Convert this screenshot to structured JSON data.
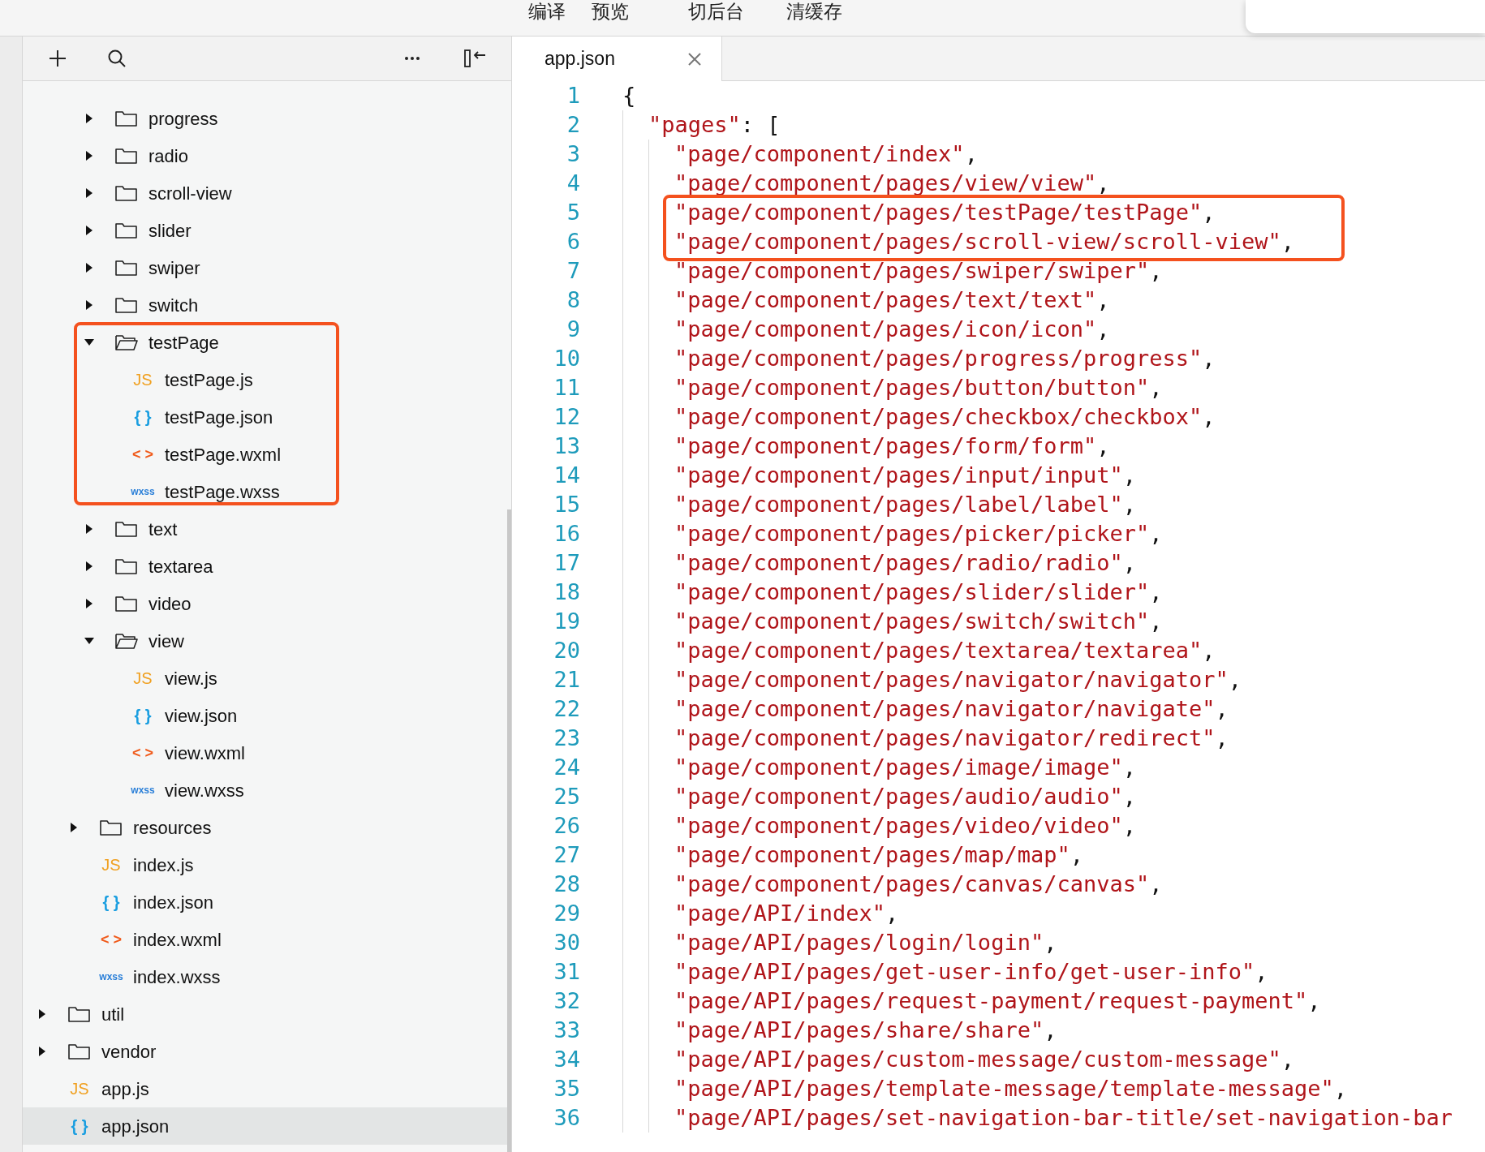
{
  "top_bar": {
    "items": [
      "编译",
      "预览",
      "切后台",
      "清缓存"
    ]
  },
  "sidebar": {
    "tree": [
      {
        "children": [
          {
            "children": [
              {
                "label": "progress",
                "kind": "folder",
                "expanded": false,
                "selected": false
              },
              {
                "label": "radio",
                "kind": "folder",
                "expanded": false,
                "selected": false
              },
              {
                "label": "scroll-view",
                "kind": "folder",
                "expanded": false,
                "selected": false
              },
              {
                "label": "slider",
                "kind": "folder",
                "expanded": false,
                "selected": false
              },
              {
                "label": "swiper",
                "kind": "folder",
                "expanded": false,
                "selected": false
              },
              {
                "label": "switch",
                "kind": "folder",
                "expanded": false,
                "selected": false
              },
              {
                "label": "testPage",
                "kind": "folder",
                "expanded": true,
                "selected": false,
                "highlighted": true,
                "children": [
                  {
                    "label": "testPage.js",
                    "kind": "js",
                    "icon": "JS",
                    "selected": false
                  },
                  {
                    "label": "testPage.json",
                    "kind": "json",
                    "icon": "{ }",
                    "selected": false
                  },
                  {
                    "label": "testPage.wxml",
                    "kind": "wxml",
                    "icon": "< >",
                    "selected": false
                  },
                  {
                    "label": "testPage.wxss",
                    "kind": "wxss",
                    "icon": "wxss",
                    "selected": false
                  }
                ]
              },
              {
                "label": "text",
                "kind": "folder",
                "expanded": false,
                "selected": false
              },
              {
                "label": "textarea",
                "kind": "folder",
                "expanded": false,
                "selected": false
              },
              {
                "label": "video",
                "kind": "folder",
                "expanded": false,
                "selected": false
              },
              {
                "label": "view",
                "kind": "folder",
                "expanded": true,
                "selected": false,
                "children": [
                  {
                    "label": "view.js",
                    "kind": "js",
                    "icon": "JS",
                    "selected": false
                  },
                  {
                    "label": "view.json",
                    "kind": "json",
                    "icon": "{ }",
                    "selected": false
                  },
                  {
                    "label": "view.wxml",
                    "kind": "wxml",
                    "icon": "< >",
                    "selected": false
                  },
                  {
                    "label": "view.wxss",
                    "kind": "wxss",
                    "icon": "wxss",
                    "selected": false
                  }
                ]
              }
            ]
          },
          {
            "label": "resources",
            "kind": "folder",
            "expanded": false,
            "selected": false
          },
          {
            "label": "index.js",
            "kind": "js",
            "icon": "JS",
            "selected": false
          },
          {
            "label": "index.json",
            "kind": "json",
            "icon": "{ }",
            "selected": false
          },
          {
            "label": "index.wxml",
            "kind": "wxml",
            "icon": "< >",
            "selected": false
          },
          {
            "label": "index.wxss",
            "kind": "wxss",
            "icon": "wxss",
            "selected": false
          }
        ]
      },
      {
        "label": "util",
        "kind": "folder",
        "expanded": false,
        "selected": false
      },
      {
        "label": "vendor",
        "kind": "folder",
        "expanded": false,
        "selected": false
      },
      {
        "label": "app.js",
        "kind": "js",
        "icon": "JS",
        "selected": false
      },
      {
        "label": "app.json",
        "kind": "json",
        "icon": "{ }",
        "selected": true
      }
    ]
  },
  "editor": {
    "tabs": [
      {
        "label": "app.json",
        "selected": true
      }
    ],
    "code": [
      {
        "number": "1",
        "tokens": [
          {
            "kind": "punct",
            "text": "{"
          }
        ],
        "children": [
          {
            "number": "2",
            "tokens": [
              {
                "kind": "key",
                "text": "\"pages\""
              },
              {
                "kind": "punct",
                "text": ": ["
              }
            ],
            "children": [
              {
                "number": "3",
                "tokens": [
                  {
                    "kind": "string",
                    "text": "\"page/component/index\""
                  },
                  {
                    "kind": "punct",
                    "text": ","
                  }
                ]
              },
              {
                "number": "4",
                "tokens": [
                  {
                    "kind": "string",
                    "text": "\"page/component/pages/view/view\""
                  },
                  {
                    "kind": "punct",
                    "text": ","
                  }
                ]
              },
              {
                "number": "5",
                "highlighted": true,
                "tokens": [
                  {
                    "kind": "string",
                    "text": "\"page/component/pages/testPage/testPage\""
                  },
                  {
                    "kind": "punct",
                    "text": ","
                  }
                ]
              },
              {
                "number": "6",
                "highlighted": true,
                "tokens": [
                  {
                    "kind": "string",
                    "text": "\"page/component/pages/scroll-view/scroll-view\""
                  },
                  {
                    "kind": "punct",
                    "text": ","
                  }
                ]
              },
              {
                "number": "7",
                "tokens": [
                  {
                    "kind": "string",
                    "text": "\"page/component/pages/swiper/swiper\""
                  },
                  {
                    "kind": "punct",
                    "text": ","
                  }
                ]
              },
              {
                "number": "8",
                "tokens": [
                  {
                    "kind": "string",
                    "text": "\"page/component/pages/text/text\""
                  },
                  {
                    "kind": "punct",
                    "text": ","
                  }
                ]
              },
              {
                "number": "9",
                "tokens": [
                  {
                    "kind": "string",
                    "text": "\"page/component/pages/icon/icon\""
                  },
                  {
                    "kind": "punct",
                    "text": ","
                  }
                ]
              },
              {
                "number": "10",
                "tokens": [
                  {
                    "kind": "string",
                    "text": "\"page/component/pages/progress/progress\""
                  },
                  {
                    "kind": "punct",
                    "text": ","
                  }
                ]
              },
              {
                "number": "11",
                "tokens": [
                  {
                    "kind": "string",
                    "text": "\"page/component/pages/button/button\""
                  },
                  {
                    "kind": "punct",
                    "text": ","
                  }
                ]
              },
              {
                "number": "12",
                "tokens": [
                  {
                    "kind": "string",
                    "text": "\"page/component/pages/checkbox/checkbox\""
                  },
                  {
                    "kind": "punct",
                    "text": ","
                  }
                ]
              },
              {
                "number": "13",
                "tokens": [
                  {
                    "kind": "string",
                    "text": "\"page/component/pages/form/form\""
                  },
                  {
                    "kind": "punct",
                    "text": ","
                  }
                ]
              },
              {
                "number": "14",
                "tokens": [
                  {
                    "kind": "string",
                    "text": "\"page/component/pages/input/input\""
                  },
                  {
                    "kind": "punct",
                    "text": ","
                  }
                ]
              },
              {
                "number": "15",
                "tokens": [
                  {
                    "kind": "string",
                    "text": "\"page/component/pages/label/label\""
                  },
                  {
                    "kind": "punct",
                    "text": ","
                  }
                ]
              },
              {
                "number": "16",
                "tokens": [
                  {
                    "kind": "string",
                    "text": "\"page/component/pages/picker/picker\""
                  },
                  {
                    "kind": "punct",
                    "text": ","
                  }
                ]
              },
              {
                "number": "17",
                "tokens": [
                  {
                    "kind": "string",
                    "text": "\"page/component/pages/radio/radio\""
                  },
                  {
                    "kind": "punct",
                    "text": ","
                  }
                ]
              },
              {
                "number": "18",
                "tokens": [
                  {
                    "kind": "string",
                    "text": "\"page/component/pages/slider/slider\""
                  },
                  {
                    "kind": "punct",
                    "text": ","
                  }
                ]
              },
              {
                "number": "19",
                "tokens": [
                  {
                    "kind": "string",
                    "text": "\"page/component/pages/switch/switch\""
                  },
                  {
                    "kind": "punct",
                    "text": ","
                  }
                ]
              },
              {
                "number": "20",
                "tokens": [
                  {
                    "kind": "string",
                    "text": "\"page/component/pages/textarea/textarea\""
                  },
                  {
                    "kind": "punct",
                    "text": ","
                  }
                ]
              },
              {
                "number": "21",
                "tokens": [
                  {
                    "kind": "string",
                    "text": "\"page/component/pages/navigator/navigator\""
                  },
                  {
                    "kind": "punct",
                    "text": ","
                  }
                ]
              },
              {
                "number": "22",
                "tokens": [
                  {
                    "kind": "string",
                    "text": "\"page/component/pages/navigator/navigate\""
                  },
                  {
                    "kind": "punct",
                    "text": ","
                  }
                ]
              },
              {
                "number": "23",
                "tokens": [
                  {
                    "kind": "string",
                    "text": "\"page/component/pages/navigator/redirect\""
                  },
                  {
                    "kind": "punct",
                    "text": ","
                  }
                ]
              },
              {
                "number": "24",
                "tokens": [
                  {
                    "kind": "string",
                    "text": "\"page/component/pages/image/image\""
                  },
                  {
                    "kind": "punct",
                    "text": ","
                  }
                ]
              },
              {
                "number": "25",
                "tokens": [
                  {
                    "kind": "string",
                    "text": "\"page/component/pages/audio/audio\""
                  },
                  {
                    "kind": "punct",
                    "text": ","
                  }
                ]
              },
              {
                "number": "26",
                "tokens": [
                  {
                    "kind": "string",
                    "text": "\"page/component/pages/video/video\""
                  },
                  {
                    "kind": "punct",
                    "text": ","
                  }
                ]
              },
              {
                "number": "27",
                "tokens": [
                  {
                    "kind": "string",
                    "text": "\"page/component/pages/map/map\""
                  },
                  {
                    "kind": "punct",
                    "text": ","
                  }
                ]
              },
              {
                "number": "28",
                "tokens": [
                  {
                    "kind": "string",
                    "text": "\"page/component/pages/canvas/canvas\""
                  },
                  {
                    "kind": "punct",
                    "text": ","
                  }
                ]
              },
              {
                "number": "29",
                "tokens": [
                  {
                    "kind": "string",
                    "text": "\"page/API/index\""
                  },
                  {
                    "kind": "punct",
                    "text": ","
                  }
                ]
              },
              {
                "number": "30",
                "tokens": [
                  {
                    "kind": "string",
                    "text": "\"page/API/pages/login/login\""
                  },
                  {
                    "kind": "punct",
                    "text": ","
                  }
                ]
              },
              {
                "number": "31",
                "tokens": [
                  {
                    "kind": "string",
                    "text": "\"page/API/pages/get-user-info/get-user-info\""
                  },
                  {
                    "kind": "punct",
                    "text": ","
                  }
                ]
              },
              {
                "number": "32",
                "tokens": [
                  {
                    "kind": "string",
                    "text": "\"page/API/pages/request-payment/request-payment\""
                  },
                  {
                    "kind": "punct",
                    "text": ","
                  }
                ]
              },
              {
                "number": "33",
                "tokens": [
                  {
                    "kind": "string",
                    "text": "\"page/API/pages/share/share\""
                  },
                  {
                    "kind": "punct",
                    "text": ","
                  }
                ]
              },
              {
                "number": "34",
                "tokens": [
                  {
                    "kind": "string",
                    "text": "\"page/API/pages/custom-message/custom-message\""
                  },
                  {
                    "kind": "punct",
                    "text": ","
                  }
                ]
              },
              {
                "number": "35",
                "tokens": [
                  {
                    "kind": "string",
                    "text": "\"page/API/pages/template-message/template-message\""
                  },
                  {
                    "kind": "punct",
                    "text": ","
                  }
                ]
              },
              {
                "number": "36",
                "tokens": [
                  {
                    "kind": "string",
                    "text": "\"page/API/pages/set-navigation-bar-title/set-navigation-bar"
                  }
                ]
              }
            ]
          }
        ]
      }
    ]
  }
}
